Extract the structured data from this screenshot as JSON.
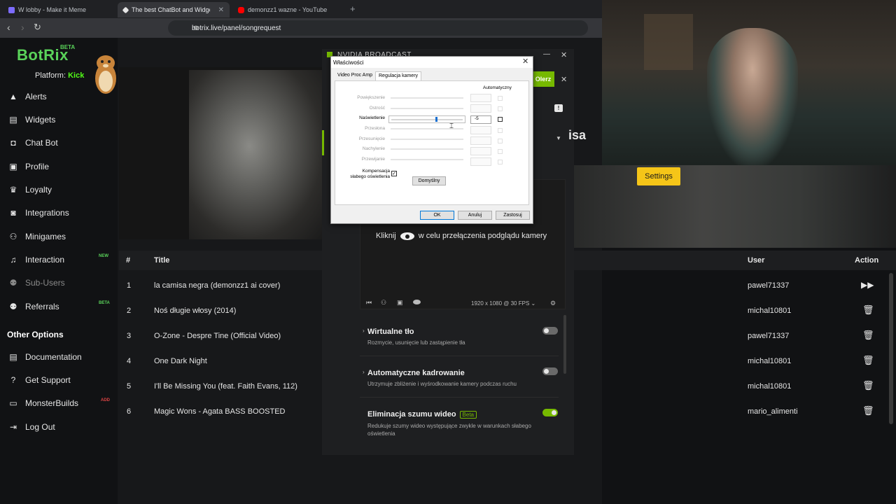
{
  "browser": {
    "tabs": [
      {
        "label": "W lobby - Make it Meme",
        "active": false
      },
      {
        "label": "The best ChatBot and Widge",
        "active": true
      },
      {
        "label": "demonzz1 wazne - YouTube",
        "active": false
      }
    ],
    "url": "botrix.live/panel/songrequest"
  },
  "sidebar": {
    "logo": "BotRix",
    "logo_badge": "BETA",
    "platform_label": "Platform:",
    "platform_value": "Kick",
    "items": [
      {
        "label": "Alerts",
        "icon": "warning-icon"
      },
      {
        "label": "Widgets",
        "icon": "widgets-icon"
      },
      {
        "label": "Chat Bot",
        "icon": "robot-icon"
      },
      {
        "label": "Profile",
        "icon": "profile-card-icon"
      },
      {
        "label": "Loyalty",
        "icon": "trophy-icon"
      },
      {
        "label": "Integrations",
        "icon": "integrations-icon"
      },
      {
        "label": "Minigames",
        "icon": "gamepad-icon"
      },
      {
        "label": "Interaction",
        "icon": "music-note-icon",
        "badge": "NEW"
      },
      {
        "label": "Sub-Users",
        "icon": "users-icon"
      },
      {
        "label": "Referrals",
        "icon": "referrals-icon",
        "badge": "BETA"
      }
    ],
    "other_options_title": "Other Options",
    "other_items": [
      {
        "label": "Documentation",
        "icon": "document-icon"
      },
      {
        "label": "Get Support",
        "icon": "question-icon"
      },
      {
        "label": "MonsterBuilds",
        "icon": "monitor-icon",
        "badge": "ADD"
      },
      {
        "label": "Log Out",
        "icon": "logout-icon"
      }
    ]
  },
  "songs": {
    "headers": {
      "num": "#",
      "title": "Title",
      "user": "User",
      "action": "Action"
    },
    "rows": [
      {
        "num": "1",
        "title": "la camisa negra (demonzz1 ai cover)",
        "user": "pawel71337",
        "action": "play-next-icon"
      },
      {
        "num": "2",
        "title": "Noś długie włosy (2014)",
        "user": "michal10801",
        "action": "trash-icon"
      },
      {
        "num": "3",
        "title": "O-Zone - Despre Tine (Official Video)",
        "user": "pawel71337",
        "action": "trash-icon"
      },
      {
        "num": "4",
        "title": "One Dark Night",
        "user": "michal10801",
        "action": "trash-icon"
      },
      {
        "num": "5",
        "title": "I'll Be Missing You (feat. Faith Evans, 112)",
        "user": "michal10801",
        "action": "trash-icon"
      },
      {
        "num": "6",
        "title": "Magic Wons - Agata BASS BOOSTED",
        "user": "mario_alimenti",
        "action": "trash-icon"
      }
    ]
  },
  "nvidia": {
    "title": "NVIDIA BROADCAST",
    "green_button": "Olerz",
    "partial_text": "isa",
    "hint_before": "Kliknij",
    "hint_after": "w celu przełączenia podglądu kamery",
    "resolution": "1920 x 1080 @ 30 FPS",
    "effects": [
      {
        "title": "Wirtualne tło",
        "desc": "Rozmycie, usunięcie lub zastąpienie tła",
        "on": false
      },
      {
        "title": "Automatyczne kadrowanie",
        "desc": "Utrzymuje zbliżenie i wyśrodkowanie kamery podczas ruchu",
        "on": false
      },
      {
        "title": "Eliminacja szumu wideo",
        "beta": "Beta",
        "desc": "Redukuje szumy wideo występujące zwykle w warunkach słabego oświetlenia",
        "on": true
      }
    ]
  },
  "dialog": {
    "title": "Właściwości",
    "tabs": [
      "Video Proc Amp",
      "Regulacja kamery"
    ],
    "auto_header": "Automatyczny",
    "props": [
      {
        "label": "Powiększenie",
        "active": false
      },
      {
        "label": "Ostrość",
        "active": false
      },
      {
        "label": "Naświetlenie",
        "active": true,
        "value": "-5",
        "level": 0.62
      },
      {
        "label": "Przesłona",
        "active": false
      },
      {
        "label": "Przesunięcie",
        "active": false
      },
      {
        "label": "Nachylenie",
        "active": false
      },
      {
        "label": "Przewijanie",
        "active": false
      }
    ],
    "compensation_label_1": "Kompensacja",
    "compensation_label_2": "słabego oświetlenia",
    "default_button": "Domyślny",
    "ok": "OK",
    "cancel": "Anuluj",
    "apply": "Zastosuj"
  },
  "webcam": {
    "settings_button": "Settings"
  },
  "colors": {
    "brand_green": "#5ad35a",
    "kick_green": "#53fc18",
    "nvidia_green": "#76b900",
    "settings_yellow": "#f5c518"
  }
}
